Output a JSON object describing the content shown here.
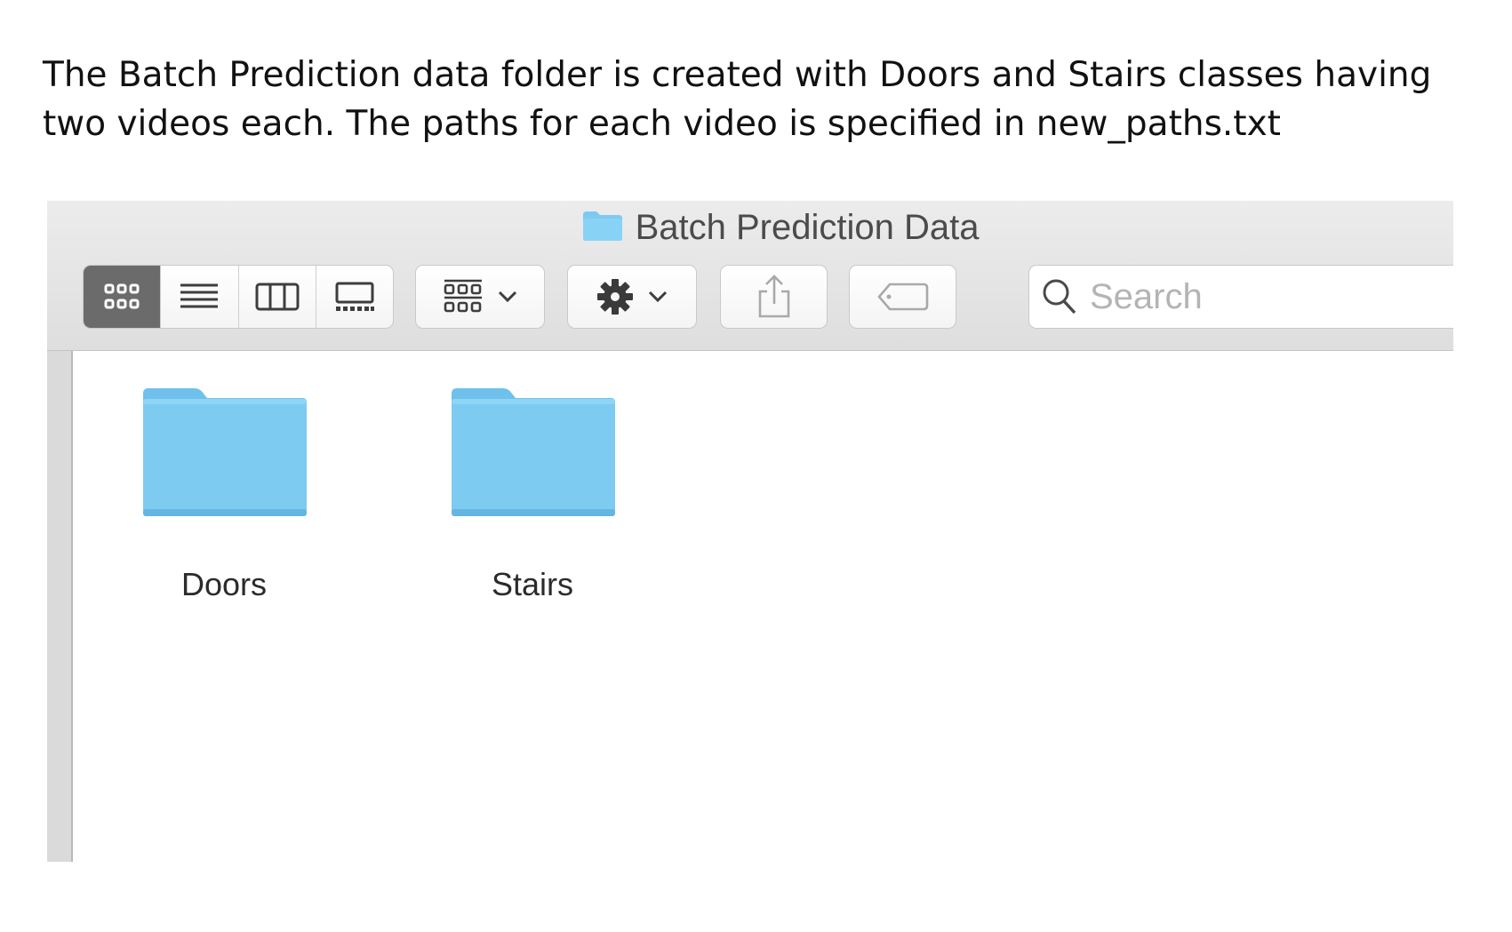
{
  "caption": {
    "line1": "The Batch Prediction data folder is created with Doors and Stairs classes having",
    "line2": "two videos each. The paths for each video is specified in new_paths.txt"
  },
  "window": {
    "title": "Batch Prediction Data"
  },
  "toolbar": {
    "view_modes": [
      "icon-view",
      "list-view",
      "column-view",
      "gallery-view"
    ],
    "active_view": "icon-view",
    "search_placeholder": "Search"
  },
  "folders": [
    {
      "name": "Doors"
    },
    {
      "name": "Stairs"
    }
  ],
  "colors": {
    "folder_blue": "#7dcbf0",
    "toolbar_bg": "#e4e4e4",
    "active_segment": "#6b6b6b"
  }
}
